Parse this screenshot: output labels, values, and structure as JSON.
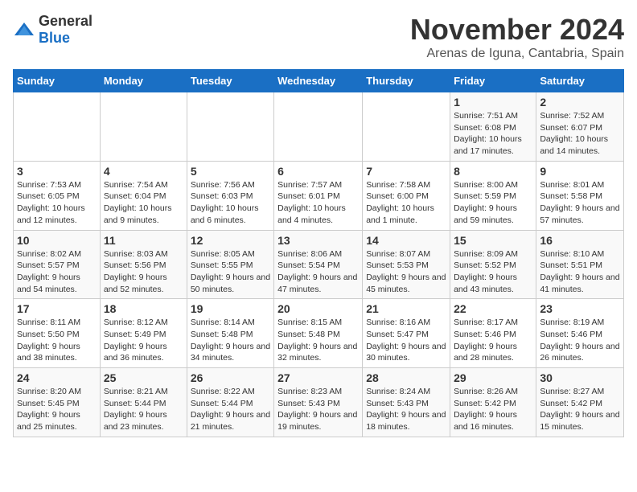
{
  "logo": {
    "general": "General",
    "blue": "Blue"
  },
  "title": "November 2024",
  "location": "Arenas de Iguna, Cantabria, Spain",
  "days_of_week": [
    "Sunday",
    "Monday",
    "Tuesday",
    "Wednesday",
    "Thursday",
    "Friday",
    "Saturday"
  ],
  "weeks": [
    [
      {
        "day": "",
        "info": ""
      },
      {
        "day": "",
        "info": ""
      },
      {
        "day": "",
        "info": ""
      },
      {
        "day": "",
        "info": ""
      },
      {
        "day": "",
        "info": ""
      },
      {
        "day": "1",
        "info": "Sunrise: 7:51 AM\nSunset: 6:08 PM\nDaylight: 10 hours and 17 minutes."
      },
      {
        "day": "2",
        "info": "Sunrise: 7:52 AM\nSunset: 6:07 PM\nDaylight: 10 hours and 14 minutes."
      }
    ],
    [
      {
        "day": "3",
        "info": "Sunrise: 7:53 AM\nSunset: 6:05 PM\nDaylight: 10 hours and 12 minutes."
      },
      {
        "day": "4",
        "info": "Sunrise: 7:54 AM\nSunset: 6:04 PM\nDaylight: 10 hours and 9 minutes."
      },
      {
        "day": "5",
        "info": "Sunrise: 7:56 AM\nSunset: 6:03 PM\nDaylight: 10 hours and 6 minutes."
      },
      {
        "day": "6",
        "info": "Sunrise: 7:57 AM\nSunset: 6:01 PM\nDaylight: 10 hours and 4 minutes."
      },
      {
        "day": "7",
        "info": "Sunrise: 7:58 AM\nSunset: 6:00 PM\nDaylight: 10 hours and 1 minute."
      },
      {
        "day": "8",
        "info": "Sunrise: 8:00 AM\nSunset: 5:59 PM\nDaylight: 9 hours and 59 minutes."
      },
      {
        "day": "9",
        "info": "Sunrise: 8:01 AM\nSunset: 5:58 PM\nDaylight: 9 hours and 57 minutes."
      }
    ],
    [
      {
        "day": "10",
        "info": "Sunrise: 8:02 AM\nSunset: 5:57 PM\nDaylight: 9 hours and 54 minutes."
      },
      {
        "day": "11",
        "info": "Sunrise: 8:03 AM\nSunset: 5:56 PM\nDaylight: 9 hours and 52 minutes."
      },
      {
        "day": "12",
        "info": "Sunrise: 8:05 AM\nSunset: 5:55 PM\nDaylight: 9 hours and 50 minutes."
      },
      {
        "day": "13",
        "info": "Sunrise: 8:06 AM\nSunset: 5:54 PM\nDaylight: 9 hours and 47 minutes."
      },
      {
        "day": "14",
        "info": "Sunrise: 8:07 AM\nSunset: 5:53 PM\nDaylight: 9 hours and 45 minutes."
      },
      {
        "day": "15",
        "info": "Sunrise: 8:09 AM\nSunset: 5:52 PM\nDaylight: 9 hours and 43 minutes."
      },
      {
        "day": "16",
        "info": "Sunrise: 8:10 AM\nSunset: 5:51 PM\nDaylight: 9 hours and 41 minutes."
      }
    ],
    [
      {
        "day": "17",
        "info": "Sunrise: 8:11 AM\nSunset: 5:50 PM\nDaylight: 9 hours and 38 minutes."
      },
      {
        "day": "18",
        "info": "Sunrise: 8:12 AM\nSunset: 5:49 PM\nDaylight: 9 hours and 36 minutes."
      },
      {
        "day": "19",
        "info": "Sunrise: 8:14 AM\nSunset: 5:48 PM\nDaylight: 9 hours and 34 minutes."
      },
      {
        "day": "20",
        "info": "Sunrise: 8:15 AM\nSunset: 5:48 PM\nDaylight: 9 hours and 32 minutes."
      },
      {
        "day": "21",
        "info": "Sunrise: 8:16 AM\nSunset: 5:47 PM\nDaylight: 9 hours and 30 minutes."
      },
      {
        "day": "22",
        "info": "Sunrise: 8:17 AM\nSunset: 5:46 PM\nDaylight: 9 hours and 28 minutes."
      },
      {
        "day": "23",
        "info": "Sunrise: 8:19 AM\nSunset: 5:46 PM\nDaylight: 9 hours and 26 minutes."
      }
    ],
    [
      {
        "day": "24",
        "info": "Sunrise: 8:20 AM\nSunset: 5:45 PM\nDaylight: 9 hours and 25 minutes."
      },
      {
        "day": "25",
        "info": "Sunrise: 8:21 AM\nSunset: 5:44 PM\nDaylight: 9 hours and 23 minutes."
      },
      {
        "day": "26",
        "info": "Sunrise: 8:22 AM\nSunset: 5:44 PM\nDaylight: 9 hours and 21 minutes."
      },
      {
        "day": "27",
        "info": "Sunrise: 8:23 AM\nSunset: 5:43 PM\nDaylight: 9 hours and 19 minutes."
      },
      {
        "day": "28",
        "info": "Sunrise: 8:24 AM\nSunset: 5:43 PM\nDaylight: 9 hours and 18 minutes."
      },
      {
        "day": "29",
        "info": "Sunrise: 8:26 AM\nSunset: 5:42 PM\nDaylight: 9 hours and 16 minutes."
      },
      {
        "day": "30",
        "info": "Sunrise: 8:27 AM\nSunset: 5:42 PM\nDaylight: 9 hours and 15 minutes."
      }
    ]
  ]
}
